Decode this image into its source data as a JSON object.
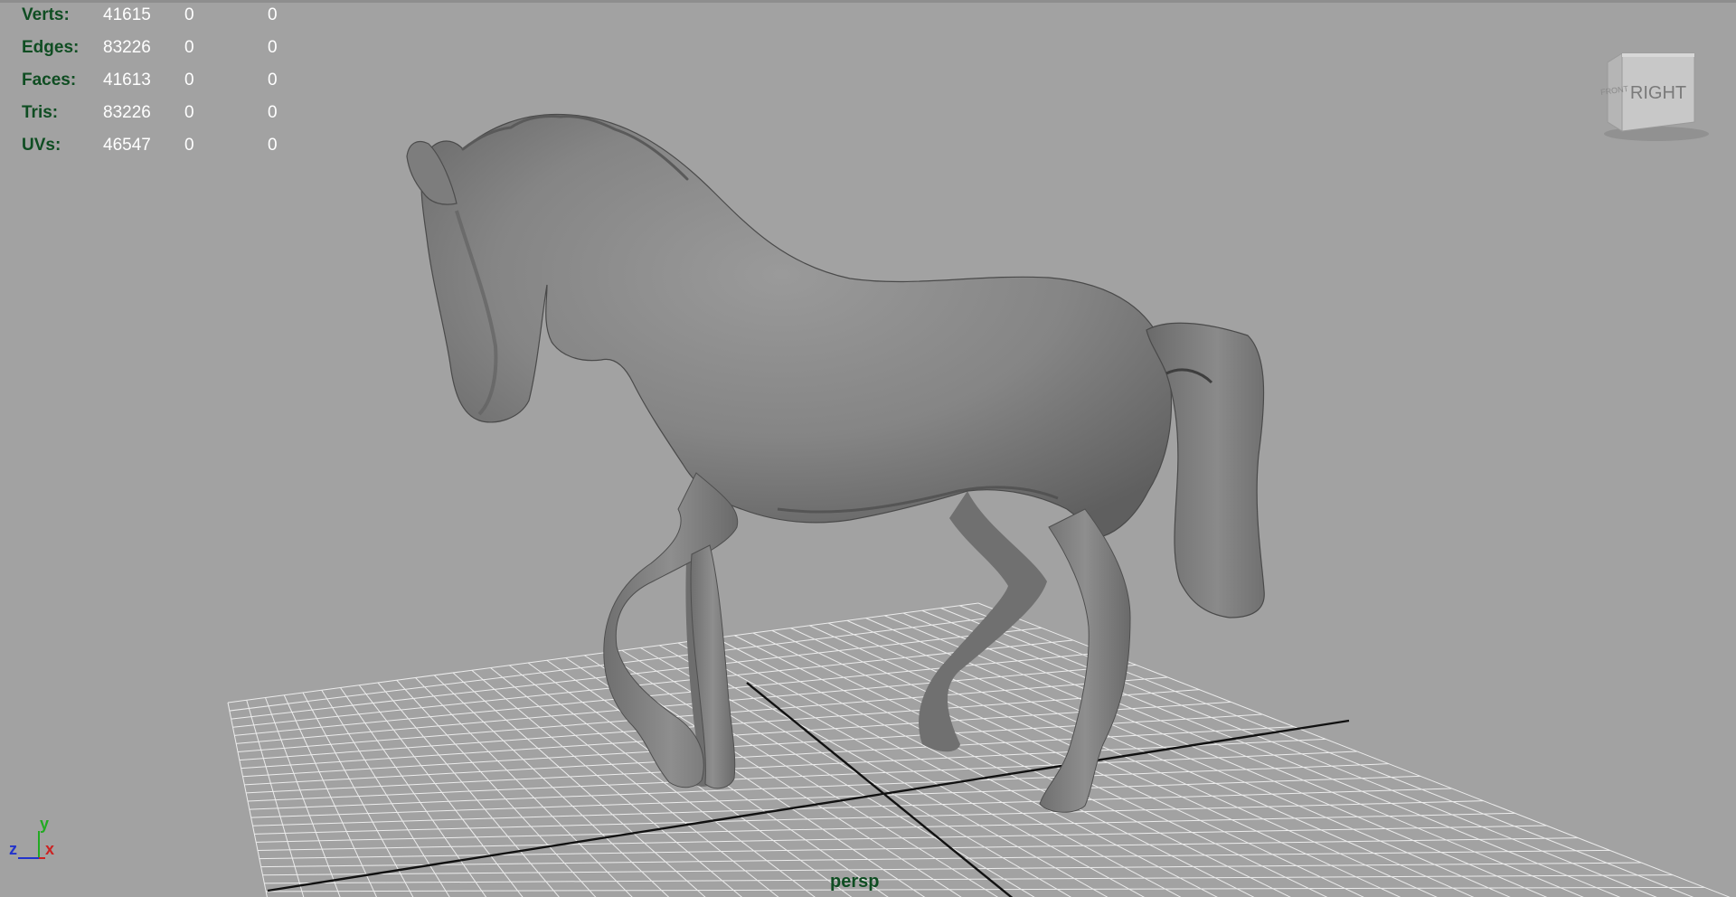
{
  "stats": {
    "rows": [
      {
        "label": "Verts:",
        "values": [
          "41615",
          "0",
          "0"
        ]
      },
      {
        "label": "Edges:",
        "values": [
          "83226",
          "0",
          "0"
        ]
      },
      {
        "label": "Faces:",
        "values": [
          "41613",
          "0",
          "0"
        ]
      },
      {
        "label": "Tris:",
        "values": [
          "83226",
          "0",
          "0"
        ]
      },
      {
        "label": "UVs:",
        "values": [
          "46547",
          "0",
          "0"
        ]
      }
    ]
  },
  "viewcube": {
    "face_right": "RIGHT",
    "face_front": "FRONT"
  },
  "viewport": {
    "camera_name": "persp"
  },
  "axis_gizmo": {
    "y": "y",
    "z": "z",
    "x": "x"
  }
}
